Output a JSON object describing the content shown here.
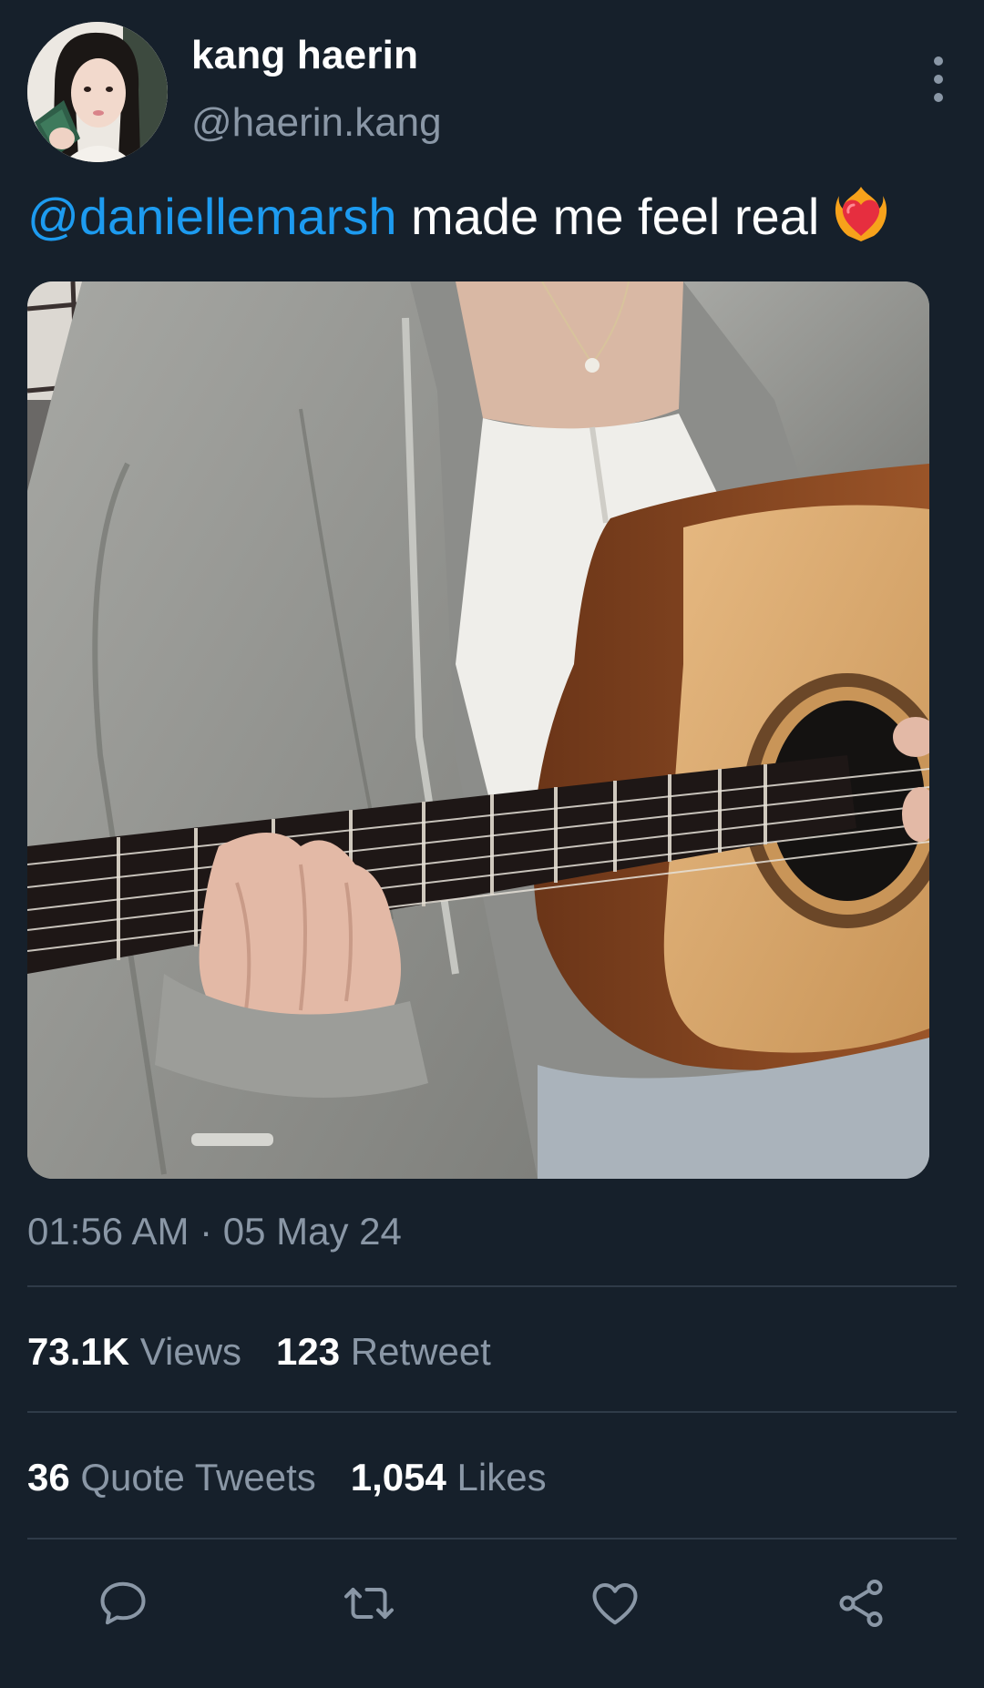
{
  "tweet": {
    "display_name": "kang haerin",
    "handle": "@haerin.kang",
    "mention": "@daniellemarsh",
    "text": " made me feel real ",
    "emoji": "heart-on-fire",
    "timestamp": "01:56 AM · 05 May 24"
  },
  "stats": {
    "views_count": "73.1K",
    "views_label": " Views",
    "retweet_count": "123",
    "retweet_label": " Retweet",
    "quote_count": "36",
    "quote_label": " Quote Tweets",
    "likes_count": "1,054",
    "likes_label": " Likes"
  },
  "icons": {
    "more": "more-vertical-icon",
    "reply": "reply-icon",
    "retweet": "retweet-icon",
    "like": "heart-icon",
    "share": "share-icon"
  },
  "colors": {
    "background": "#16202b",
    "mention": "#1d9bf0",
    "secondary_text": "#8a97a6",
    "divider": "#2f3b48"
  }
}
